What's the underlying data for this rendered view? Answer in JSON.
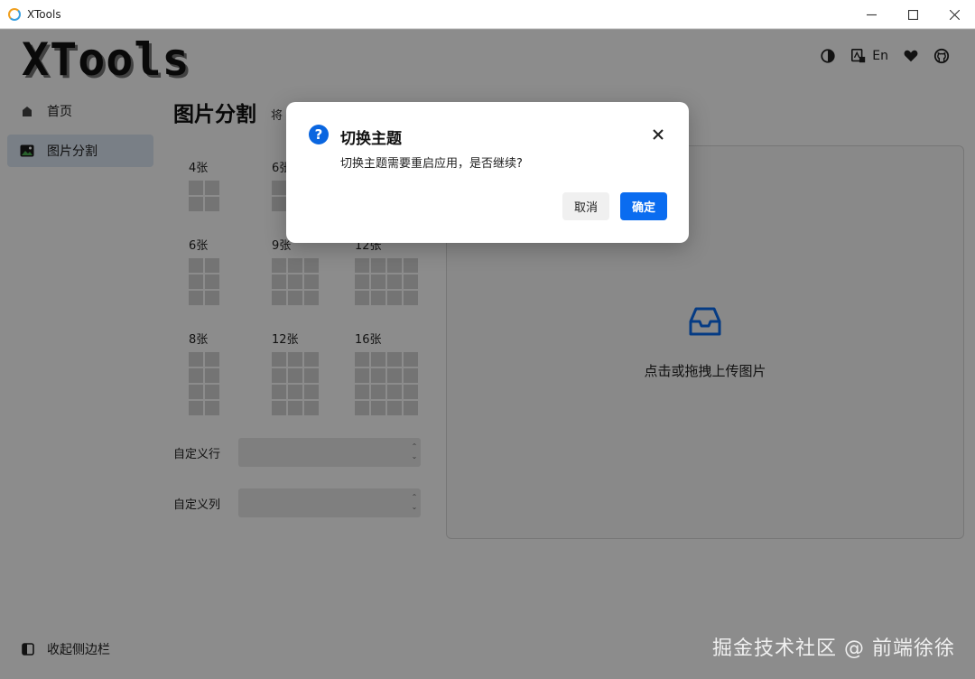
{
  "window": {
    "title": "XTools"
  },
  "app": {
    "logo": "XTools",
    "header": {
      "lang_label": "En"
    },
    "sidebar": {
      "items": [
        {
          "label": "首页",
          "icon": "home-icon"
        },
        {
          "label": "图片分割",
          "icon": "image-icon",
          "active": true
        }
      ],
      "collapse_label": "收起侧边栏"
    },
    "main": {
      "title": "图片分割",
      "subtitle": "将",
      "layouts": [
        {
          "label": "4张",
          "cols": 2,
          "rows": 2
        },
        {
          "label": "6张",
          "cols": 3,
          "rows": 2
        },
        {
          "label": "6张",
          "cols": 2,
          "rows": 3
        },
        {
          "label": "9张",
          "cols": 3,
          "rows": 3
        },
        {
          "label": "12张",
          "cols": 4,
          "rows": 3
        },
        {
          "label": "8张",
          "cols": 2,
          "rows": 4
        },
        {
          "label": "12张",
          "cols": 3,
          "rows": 4
        },
        {
          "label": "16张",
          "cols": 4,
          "rows": 4
        }
      ],
      "custom_row_label": "自定义行",
      "custom_col_label": "自定义列",
      "upload_text": "点击或拖拽上传图片"
    }
  },
  "dialog": {
    "title": "切换主题",
    "message": "切换主题需要重启应用，是否继续?",
    "cancel_label": "取消",
    "ok_label": "确定"
  },
  "watermark": "掘金技术社区 @ 前端徐徐",
  "colors": {
    "accent": "#0a6cf0",
    "mask": "rgba(0,0,0,0.45)"
  }
}
